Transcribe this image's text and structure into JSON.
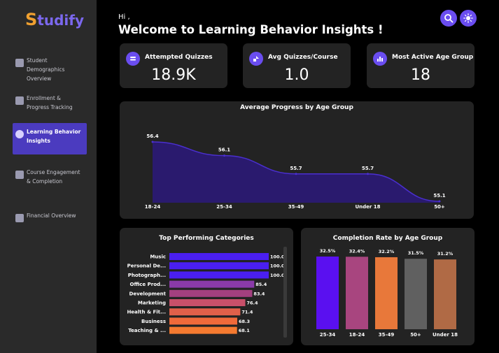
{
  "sidebar": {
    "logo_first": "S",
    "logo_rest": "tudify",
    "items": [
      {
        "label": "Student Demographics Overview",
        "icon": "users-icon",
        "active": false
      },
      {
        "label": "Enrollment & Progress Tracking",
        "icon": "progress-icon",
        "active": false
      },
      {
        "label": "Learning Behavior Insights",
        "icon": "brain-icon",
        "active": true
      },
      {
        "label": "Course Engagement & Completion",
        "icon": "course-icon",
        "active": false
      },
      {
        "label": "Financial Overview",
        "icon": "finance-icon",
        "active": false
      }
    ]
  },
  "header": {
    "greeting": "Hi ,",
    "title": "Welcome to Learning Behavior Insights !"
  },
  "kpis": [
    {
      "title": "Attempted Quizzes",
      "value": "18.9K",
      "icon": "quiz-icon"
    },
    {
      "title": "Avg Quizzes/Course",
      "value": "1.0",
      "icon": "avg-icon"
    },
    {
      "title": "Most Active Age Group",
      "value": "18",
      "icon": "chart-icon"
    }
  ],
  "colors": {
    "accent": "#6a4df0",
    "area_fill": "#2a1a6e",
    "area_line": "#4a2fd0"
  },
  "chart_data": [
    {
      "type": "area",
      "title": "Average Progress by Age Group",
      "categories": [
        "18-24",
        "25-34",
        "35-49",
        "Under 18",
        "50+"
      ],
      "values": [
        56.4,
        56.1,
        55.7,
        55.7,
        55.1
      ],
      "labels": [
        "56.4",
        "56.1",
        "55.7",
        "55.7",
        "55.1"
      ]
    },
    {
      "type": "bar",
      "orientation": "horizontal",
      "title": "Top Performing Categories",
      "categories": [
        "Music",
        "Personal De...",
        "Photograph...",
        "Office Prod...",
        "Development",
        "Marketing",
        "Health & Fit...",
        "Business",
        "Teaching & ..."
      ],
      "values": [
        100.0,
        100.0,
        100.0,
        85.4,
        83.4,
        76.4,
        71.4,
        68.3,
        68.1
      ],
      "labels": [
        "100.0",
        "100.0",
        "100.0",
        "85.4",
        "83.4",
        "76.4",
        "71.4",
        "68.3",
        "68.1"
      ],
      "colors": [
        "#4a1ff0",
        "#4a1ff0",
        "#4a1ff0",
        "#8a3aa8",
        "#a3407f",
        "#c8506a",
        "#e0604a",
        "#f06a3a",
        "#f57a30"
      ]
    },
    {
      "type": "bar",
      "title": "Completion Rate by Age Group",
      "categories": [
        "25-34",
        "18-24",
        "35-49",
        "50+",
        "Under 18"
      ],
      "values": [
        32.5,
        32.4,
        32.2,
        31.5,
        31.2
      ],
      "labels": [
        "32.5%",
        "32.4%",
        "32.2%",
        "31.5%",
        "31.2%"
      ],
      "colors": [
        "#5a10f0",
        "#a8457f",
        "#e8783a",
        "#606060",
        "#b06a45"
      ]
    }
  ]
}
